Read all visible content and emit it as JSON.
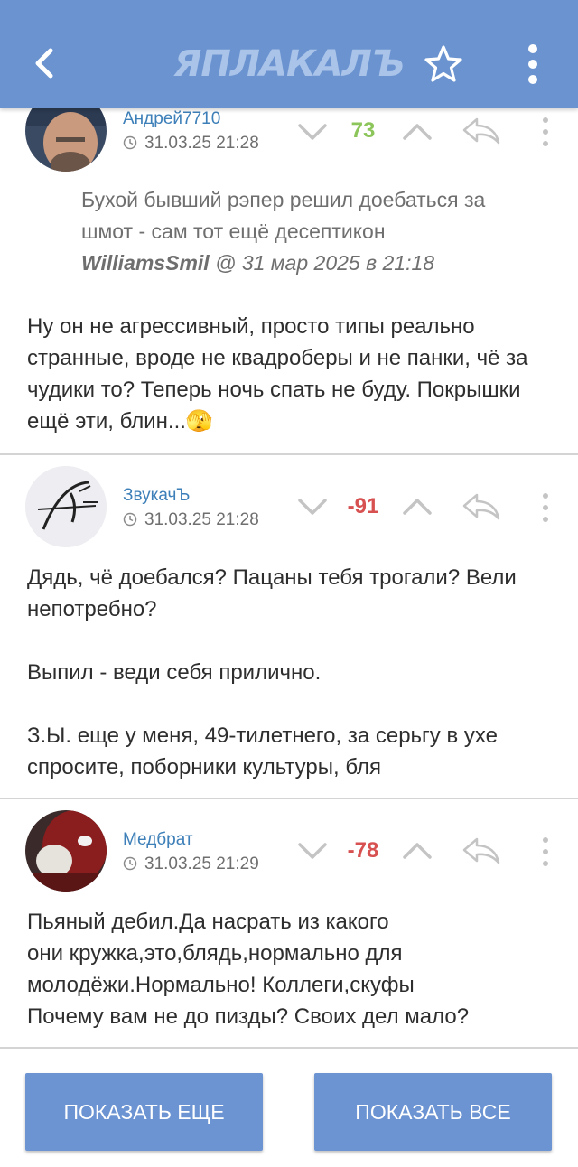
{
  "header": {
    "logo_text": "ЯПЛАКАЛЪ",
    "back_icon": "chevron-left-icon",
    "favorite_icon": "star-outline-icon",
    "menu_icon": "vertical-dots-icon"
  },
  "comments": [
    {
      "author": "Андрей7710",
      "datetime": "31.03.25 21:28",
      "score": "73",
      "score_color": "#8cc55a",
      "quote": {
        "text": "Бухой бывший рэпер решил доебаться за шмот - сам тот ещё десептикон",
        "author": "WilliamsSmil",
        "meta": " @ 31 мар 2025 в 21:18"
      },
      "text": "Ну он не агрессивный, просто типы реально странные, вроде не квадроберы и не панки, чё за чудики то? Теперь ночь спать не буду. Покрышки ещё эти, блин...🫣"
    },
    {
      "author": "ЗвукачЪ",
      "datetime": "31.03.25 21:28",
      "score": "-91",
      "score_color": "#d85151",
      "text": "Дядь, чё доебался? Пацаны тебя трогали? Вели непотребно?\n\nВыпил - веди себя прилично.\n\nЗ.Ы. еще у меня, 49-тилетнего, за серьгу в ухе спросите, поборники культуры, бля"
    },
    {
      "author": "Медбрат",
      "datetime": "31.03.25 21:29",
      "score": "-78",
      "score_color": "#d85151",
      "text": "Пьяный дебил.Да насрать из какого\nони кружка,это,блядь,нормально для\nмолодёжи.Нормально! Коллеги,скуфы\nПочему вам не до пизды? Своих дел мало?"
    }
  ],
  "buttons": {
    "show_more": "ПОКАЗАТЬ ЕЩЕ",
    "show_all": "ПОКАЗАТЬ ВСЕ"
  },
  "colors": {
    "appbar": "#6a93d0",
    "button": "#6c94d2",
    "author": "#3d7fb8"
  }
}
